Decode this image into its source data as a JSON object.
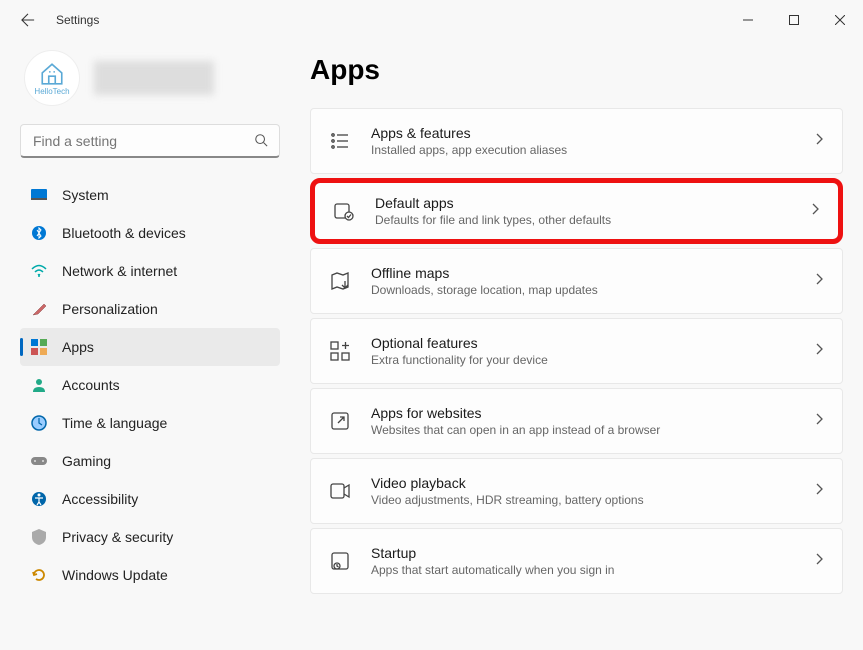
{
  "window": {
    "title": "Settings"
  },
  "profile": {
    "avatar_label": "HelloTech"
  },
  "search": {
    "placeholder": "Find a setting"
  },
  "sidebar": {
    "items": [
      {
        "label": "System"
      },
      {
        "label": "Bluetooth & devices"
      },
      {
        "label": "Network & internet"
      },
      {
        "label": "Personalization"
      },
      {
        "label": "Apps"
      },
      {
        "label": "Accounts"
      },
      {
        "label": "Time & language"
      },
      {
        "label": "Gaming"
      },
      {
        "label": "Accessibility"
      },
      {
        "label": "Privacy & security"
      },
      {
        "label": "Windows Update"
      }
    ]
  },
  "page": {
    "title": "Apps"
  },
  "cards": [
    {
      "title": "Apps & features",
      "subtitle": "Installed apps, app execution aliases"
    },
    {
      "title": "Default apps",
      "subtitle": "Defaults for file and link types, other defaults"
    },
    {
      "title": "Offline maps",
      "subtitle": "Downloads, storage location, map updates"
    },
    {
      "title": "Optional features",
      "subtitle": "Extra functionality for your device"
    },
    {
      "title": "Apps for websites",
      "subtitle": "Websites that can open in an app instead of a browser"
    },
    {
      "title": "Video playback",
      "subtitle": "Video adjustments, HDR streaming, battery options"
    },
    {
      "title": "Startup",
      "subtitle": "Apps that start automatically when you sign in"
    }
  ]
}
